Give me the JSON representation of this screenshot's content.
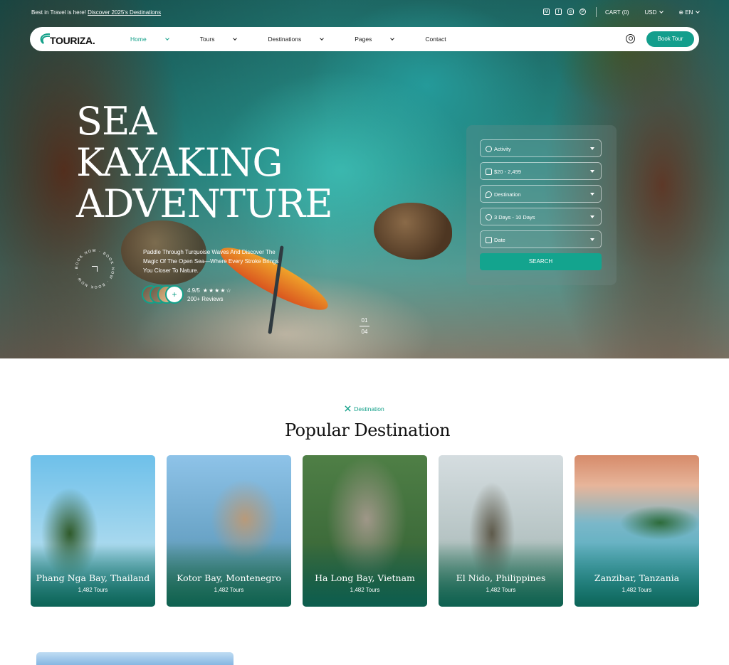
{
  "topbar": {
    "message": "Best in Travel is here!",
    "message_link": "Discover 2025's Destinations",
    "social_icons": [
      "medium-icon",
      "facebook-icon",
      "instagram-icon",
      "pinterest-icon"
    ],
    "cart": "CART (0)",
    "currency": "USD",
    "language": "EN"
  },
  "navbar": {
    "logo": "TOURIZA.",
    "items": [
      {
        "label": "Home",
        "active": true,
        "dropdown": true
      },
      {
        "label": "Tours",
        "dropdown": true
      },
      {
        "label": "Destinations",
        "dropdown": true
      },
      {
        "label": "Pages",
        "dropdown": true
      },
      {
        "label": "Contact",
        "dropdown": false
      }
    ],
    "book_label": "Book Tour",
    "accent": "#139e8c"
  },
  "hero": {
    "title_lines": [
      "SEA",
      "KAYAKING",
      "ADVENTURE"
    ],
    "description": "Paddle Through Turquoise Waves And Discover The Magic Of The Open Sea—Where Every Stroke Brings You Closer To Nature.",
    "badge_text": "BOOK NOW · BOOK NOW · BOOK NOW ·",
    "rating": "4.9/5",
    "stars": "★★★★☆",
    "reviews": "200+ Reviews",
    "avatar_plus": "+",
    "slide_current": "01",
    "slide_total": "04"
  },
  "search": {
    "fields": [
      {
        "label": "Activity",
        "icon": "bike-icon"
      },
      {
        "label": "$20 - 2,499",
        "icon": "money-icon"
      },
      {
        "label": "Destination",
        "icon": "location-pin-icon"
      },
      {
        "label": "3 Days - 10 Days",
        "icon": "clock-icon"
      },
      {
        "label": "Date",
        "icon": "calendar-icon"
      }
    ],
    "button": "SEARCH"
  },
  "destinations": {
    "tag": "Destination",
    "title": "Popular Destination",
    "cards": [
      {
        "name": "Phang Nga Bay, Thailand",
        "tours": "1,482 Tours"
      },
      {
        "name": "Kotor Bay, Montenegro",
        "tours": "1,482 Tours"
      },
      {
        "name": "Ha Long Bay, Vietnam",
        "tours": "1,482 Tours"
      },
      {
        "name": "El Nido, Philippines",
        "tours": "1,482 Tours"
      },
      {
        "name": "Zanzibar, Tanzania",
        "tours": "1,482 Tours"
      }
    ]
  }
}
